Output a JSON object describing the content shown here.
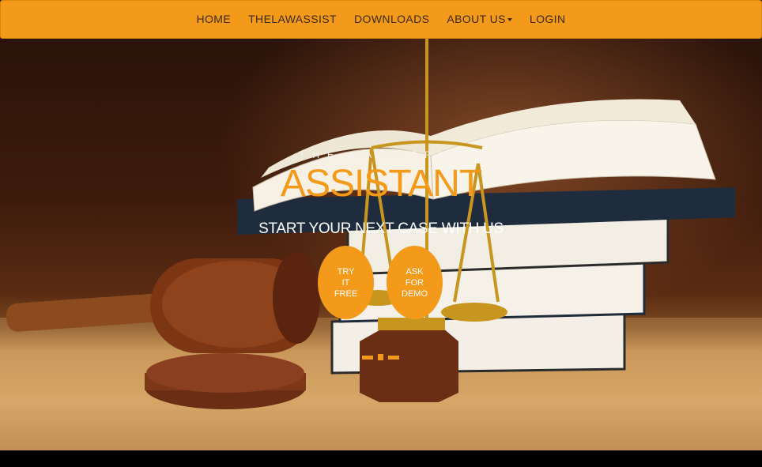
{
  "nav": {
    "items": [
      {
        "label": "HOME"
      },
      {
        "label": "THELAWASSIST"
      },
      {
        "label": "DOWNLOADS"
      },
      {
        "label": "ABOUT US",
        "has_dropdown": true
      },
      {
        "label": "LOGIN"
      }
    ]
  },
  "hero": {
    "kicker": "THE LAWYER'S",
    "headline": "ASSISTANT",
    "subline": "START YOUR NEXT CASE WITH US",
    "buttons": {
      "try_free": [
        "TRY",
        "IT",
        "FREE"
      ],
      "ask_demo": [
        "ASK",
        "FOR",
        "DEMO"
      ]
    },
    "carousel": {
      "slides": 3,
      "active_index": 1
    }
  },
  "colors": {
    "accent": "#f39a1a",
    "nav_text": "#3c2a12",
    "headline": "#f39a1a",
    "subline": "#ffffff"
  },
  "icons": {
    "dropdown": "caret-down-icon"
  }
}
